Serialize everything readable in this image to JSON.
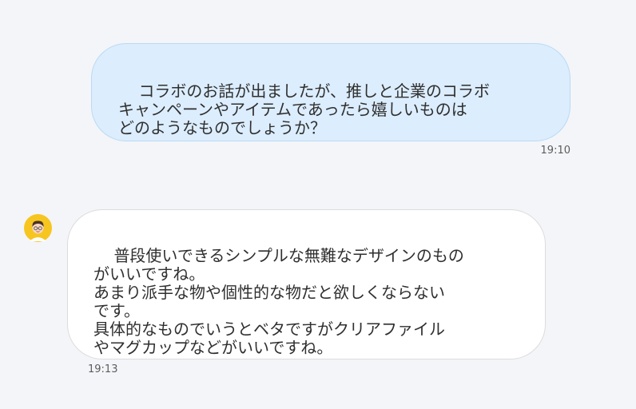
{
  "chat": {
    "messages": [
      {
        "sender": "user",
        "text": "コラボのお話が出ましたが、推しと企業のコラボ\nキャンペーンやアイテムであったら嬉しいものは\nどのようなものでしょうか？",
        "time": "19:10"
      },
      {
        "sender": "bot",
        "text": "普段使いできるシンプルな無難なデザインのもの\nがいいですね。\nあまり派手な物や個性的な物だと欲しくならない\nです。\n具体的なものでいうとベタですがクリアファイル\nやマグカップなどがいいですね。",
        "time": "19:13",
        "avatar": "avatar-icon"
      }
    ]
  },
  "colors": {
    "background": "#f4f5f8",
    "user_bubble": "#dcedfd",
    "bot_bubble": "#ffffff",
    "avatar_bg": "#f7c51f"
  }
}
